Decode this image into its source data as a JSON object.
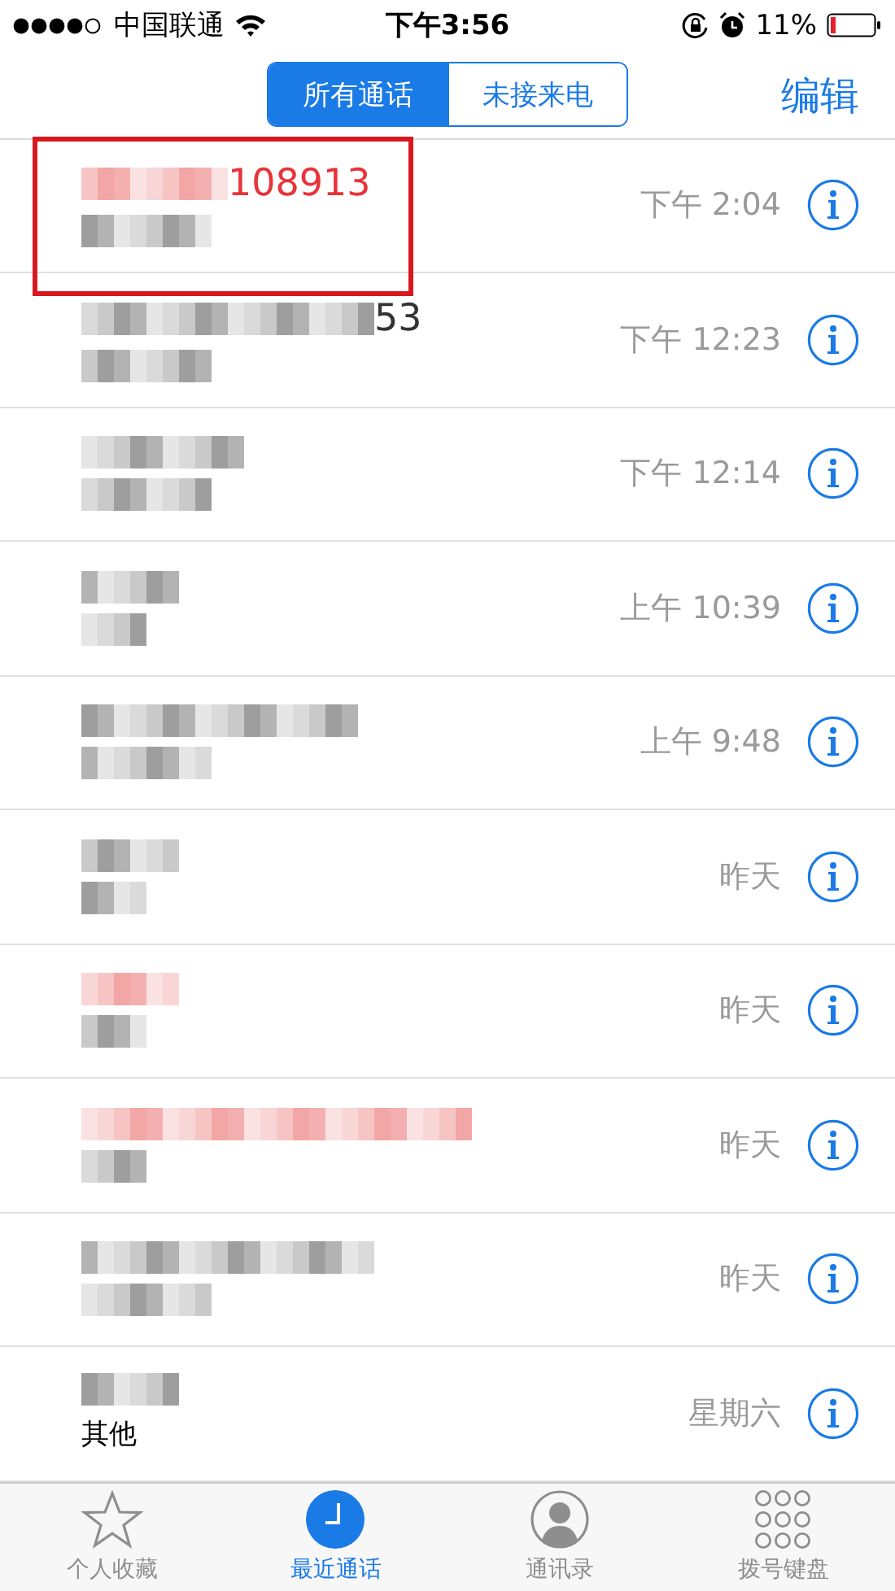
{
  "status_bar": {
    "carrier": "中国联通",
    "time": "下午3:56",
    "battery": "11%"
  },
  "segments": [
    {
      "label": "所有通话",
      "selected": true
    },
    {
      "label": "未接来电",
      "selected": false
    }
  ],
  "edit_button": "编辑",
  "calls": [
    {
      "name": "108913",
      "missed": true,
      "time": "下午 2:04",
      "highlighted": true
    },
    {
      "name": "53",
      "missed": false,
      "time": "下午 12:23",
      "highlighted": false
    },
    {
      "missed": false,
      "time": "下午 12:14",
      "highlighted": false
    },
    {
      "missed": false,
      "time": "上午 10:39",
      "highlighted": false
    },
    {
      "missed": false,
      "time": "上午 9:48",
      "highlighted": false
    },
    {
      "missed": false,
      "time": "昨天",
      "highlighted": false
    },
    {
      "missed": true,
      "time": "昨天",
      "highlighted": false
    },
    {
      "missed": true,
      "time": "昨天",
      "highlighted": false
    },
    {
      "missed": false,
      "time": "昨天",
      "highlighted": false
    },
    {
      "missed": false,
      "time": "星期六",
      "detail": "其他",
      "highlighted": false
    }
  ],
  "tab_bar": [
    {
      "kind": "star",
      "label": "个人收藏",
      "selected": false
    },
    {
      "kind": "clock",
      "label": "最近通话",
      "selected": true
    },
    {
      "kind": "person",
      "label": "通讯录",
      "selected": false
    },
    {
      "kind": "keypad",
      "label": "拨号键盘",
      "selected": false
    }
  ]
}
